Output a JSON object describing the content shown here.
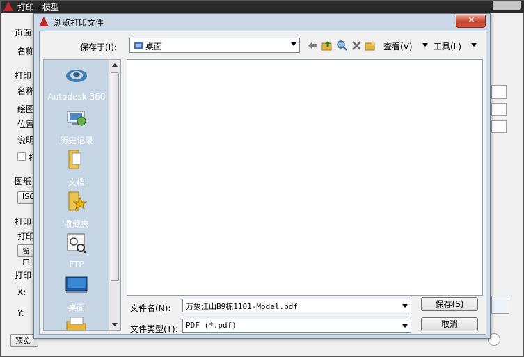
{
  "background_window": {
    "title": "打印 - 模型",
    "labels": [
      "页面",
      "名称",
      "打印",
      "名称",
      "绘图",
      "位置",
      "说明",
      "打",
      "图纸",
      "ISO",
      "打印",
      "打印",
      "窗口",
      "打印",
      "X:",
      "Y:",
      "预览"
    ]
  },
  "dialog": {
    "title": "浏览打印文件",
    "save_in_label": "保存于(I):",
    "save_in_value": "桌面",
    "toolbar": {
      "view_label": "查看(V)",
      "tools_label": "工具(L)"
    },
    "places": [
      {
        "label": "Autodesk 360",
        "icon": "autodesk-360-icon"
      },
      {
        "label": "历史记录",
        "icon": "history-icon"
      },
      {
        "label": "文档",
        "icon": "documents-folder-icon"
      },
      {
        "label": "收藏夹",
        "icon": "favorites-icon"
      },
      {
        "label": "FTP",
        "icon": "ftp-icon"
      },
      {
        "label": "桌面",
        "icon": "desktop-icon"
      }
    ],
    "filename_label": "文件名(N):",
    "filename_value": "万象江山B9栋1101-Model.pdf",
    "filetype_label": "文件类型(T):",
    "filetype_value": "PDF (*.pdf)",
    "save_button": "保存(S)",
    "cancel_button": "取消"
  },
  "colors": {
    "dialog_frame": "#cbd8e6",
    "places_bar": "#c6d5e3",
    "close_button": "#c7422b"
  }
}
